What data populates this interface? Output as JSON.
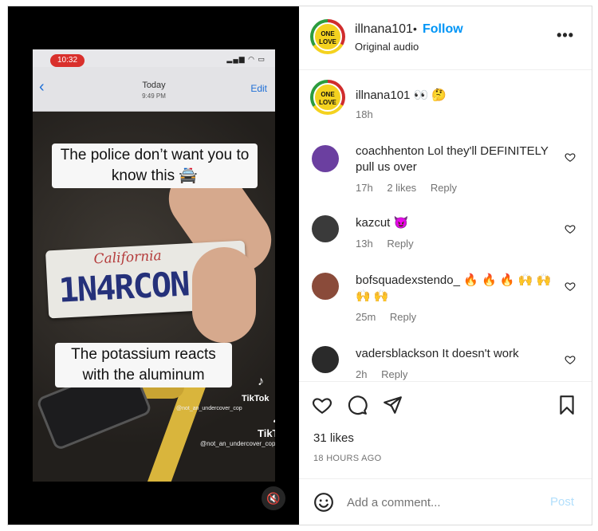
{
  "header": {
    "username": "illnana101",
    "separator": "•",
    "follow_label": "Follow",
    "audio": "Original audio",
    "avatar_text": "ONE LOVE"
  },
  "video": {
    "status_time": "10:32",
    "status_icons": "▂▄▆ ◠ ▭",
    "nav_today": "Today",
    "nav_time": "9:49 PM",
    "nav_edit": "Edit",
    "plate_state": "California",
    "plate_number": "1N4RCON",
    "caption_top": "The police don’t want you to know this 🚔",
    "caption_bottom": "The potassium reacts with the aluminum",
    "tiktok_small": "TikTok",
    "tiktok_handle_small": "@not_an_undercover_cop",
    "tiktok_big": "TikTok",
    "tiktok_handle_big": "@not_an_undercover_cop",
    "mute_icon": "🔇"
  },
  "caption_post": {
    "username": "illnana101",
    "text": "👀 🤔",
    "time": "18h"
  },
  "comments": [
    {
      "username": "coachhenton",
      "text": "Lol they'll DEFINITELY pull us over",
      "time": "17h",
      "likes": "2 likes",
      "reply": "Reply",
      "avatar_color": "#6b3fa0"
    },
    {
      "username": "kazcut",
      "text": "😈",
      "time": "13h",
      "likes": "",
      "reply": "Reply",
      "avatar_color": "#3a3a3a"
    },
    {
      "username": "bofsquadexstendo_",
      "text": "🔥 🔥 🔥 🙌 🙌 🙌 🙌",
      "time": "25m",
      "likes": "",
      "reply": "Reply",
      "avatar_color": "#8a4b3a"
    },
    {
      "username": "vadersblackson",
      "text": "It doesn't work",
      "time": "2h",
      "likes": "",
      "reply": "Reply",
      "avatar_color": "#2a2a2a"
    }
  ],
  "stats": {
    "likes": "31 likes",
    "age": "18 HOURS AGO"
  },
  "composer": {
    "placeholder": "Add a comment...",
    "post_label": "Post"
  }
}
